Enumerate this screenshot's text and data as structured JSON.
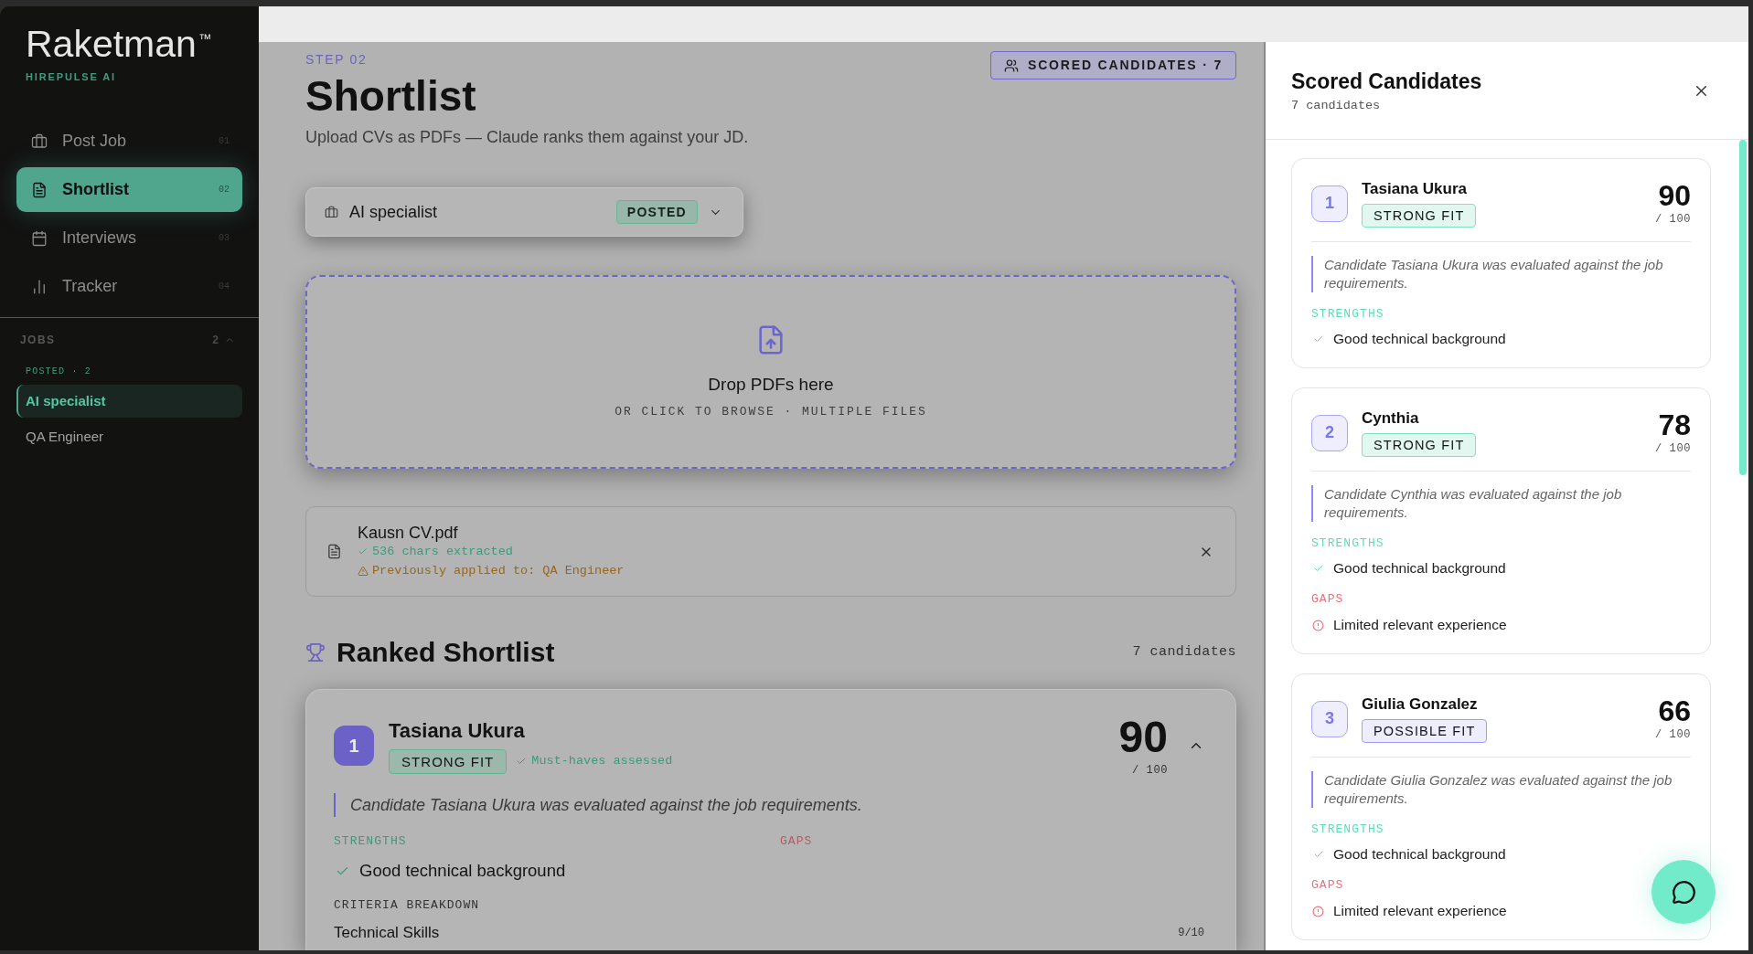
{
  "sidebar": {
    "logo": "Raketman$^{™}$",
    "tagline": "HIREPULSE AI",
    "nav": [
      {
        "label": "Post Job",
        "number": "01",
        "selected": false
      },
      {
        "label": "Shortlist",
        "number": "02",
        "selected": true
      },
      {
        "label": "Interviews",
        "number": "03",
        "selected": false
      },
      {
        "label": "Tracker",
        "number": "04",
        "selected": false
      }
    ],
    "jobs": {
      "title": "JOBS",
      "count": "2",
      "expanded": true,
      "group": "POSTED · 2",
      "items": [
        {
          "label": "AI specialist",
          "selected": true
        },
        {
          "label": "QA Engineer",
          "selected": false
        }
      ]
    }
  },
  "main": {
    "step": "STEP 02",
    "title": "Shortlist",
    "subtitle": "Upload CVs as PDFs — Claude ranks them against your JD.",
    "scored_button": "SCORED CANDIDATES · 7",
    "job_select": {
      "value": "AI specialist",
      "status": "POSTED"
    },
    "dropzone": {
      "title": "Drop PDFs here",
      "hint": "OR CLICK TO BROWSE · MULTIPLE FILES"
    },
    "files": [
      {
        "name": "Kausn CV.pdf",
        "extracted": "536 chars extracted",
        "warning": "Previously applied to: QA Engineer"
      }
    ],
    "ranked": {
      "title": "Ranked Shortlist",
      "count": "7 candidates",
      "candidates": [
        {
          "rank": "1",
          "name": "Tasiana Ukura",
          "fit": "STRONG FIT",
          "kind": "strong",
          "note": "Must-haves assessed",
          "score": "90",
          "scale": "/ 100",
          "expanded": true,
          "summary": "Candidate Tasiana Ukura was evaluated against the job requirements.",
          "strengths_label": "STRENGTHS",
          "strengths": [
            "Good technical background"
          ],
          "gaps_label": "GAPS",
          "criteria_label": "CRITERIA BREAKDOWN",
          "criteria": [
            {
              "name": "Technical Skills",
              "score": "9/10"
            }
          ]
        }
      ]
    }
  },
  "drawer": {
    "title": "Scored Candidates",
    "count": "7 candidates",
    "candidates": [
      {
        "rank": "1",
        "name": "Tasiana Ukura",
        "fit": "STRONG FIT",
        "kind": "strong",
        "score": "90",
        "scale": "/ 100",
        "summary": "Candidate Tasiana Ukura was evaluated against the job requirements.",
        "strengths_label": "STRENGTHS",
        "strengths": [
          "Good technical background"
        ]
      },
      {
        "rank": "2",
        "name": "Cynthia",
        "fit": "STRONG FIT",
        "kind": "strong",
        "score": "78",
        "scale": "/ 100",
        "summary": "Candidate Cynthia was evaluated against the job requirements.",
        "strengths_label": "STRENGTHS",
        "strengths": [
          "Good technical background"
        ],
        "gaps_label": "GAPS",
        "gaps": [
          "Limited relevant experience"
        ]
      },
      {
        "rank": "3",
        "name": "Giulia Gonzalez",
        "fit": "POSSIBLE FIT",
        "kind": "possible",
        "score": "66",
        "scale": "/ 100",
        "summary": "Candidate Giulia Gonzalez was evaluated against the job requirements.",
        "strengths_label": "STRENGTHS",
        "strengths": [
          "Good technical background"
        ],
        "gaps_label": "GAPS",
        "gaps": [
          "Limited relevant experience"
        ]
      }
    ]
  }
}
